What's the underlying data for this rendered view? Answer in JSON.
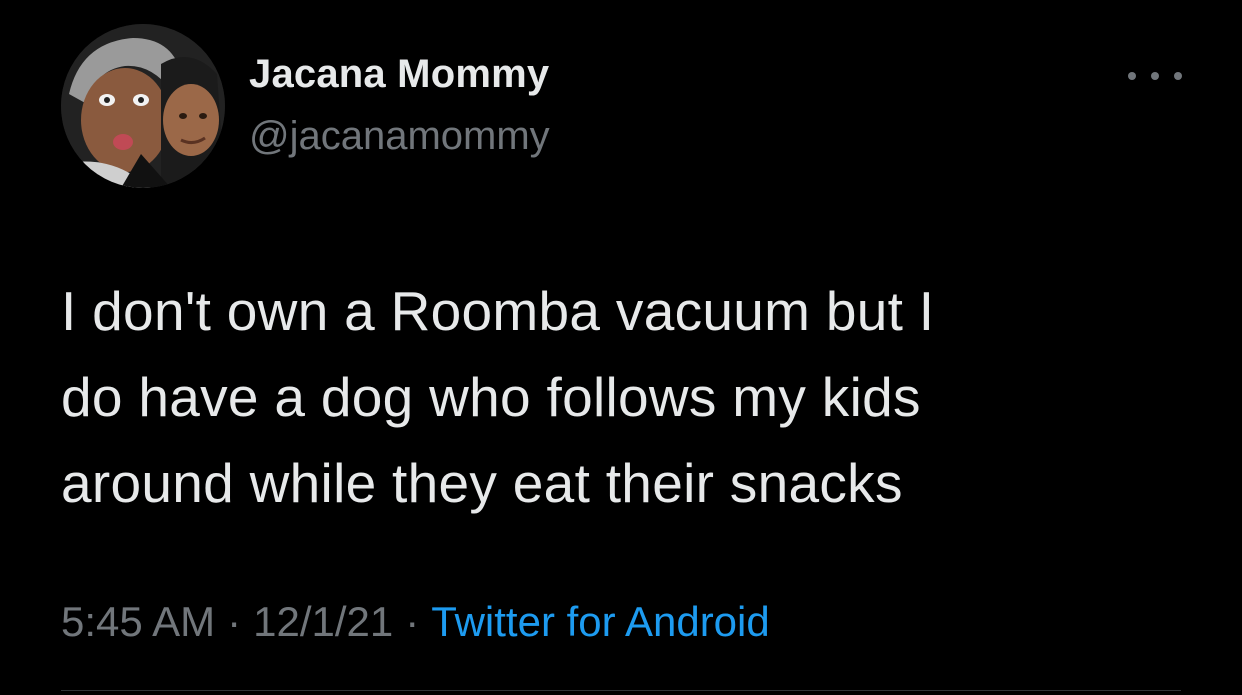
{
  "author": {
    "display_name": "Jacana Mommy",
    "handle": "@jacanamommy",
    "avatar_icon": "profile-photo"
  },
  "more_icon": "more-options-icon",
  "tweet": {
    "lines": [
      "I don't own a Roomba vacuum but I",
      "do have a dog who follows my kids",
      "around while they eat their snacks"
    ]
  },
  "meta": {
    "time": "5:45 AM",
    "separator": "·",
    "date": "12/1/21",
    "source": "Twitter for Android"
  },
  "colors": {
    "background": "#000000",
    "text": "#e7e9ea",
    "secondary": "#71767b",
    "accent": "#1d9bf0"
  }
}
